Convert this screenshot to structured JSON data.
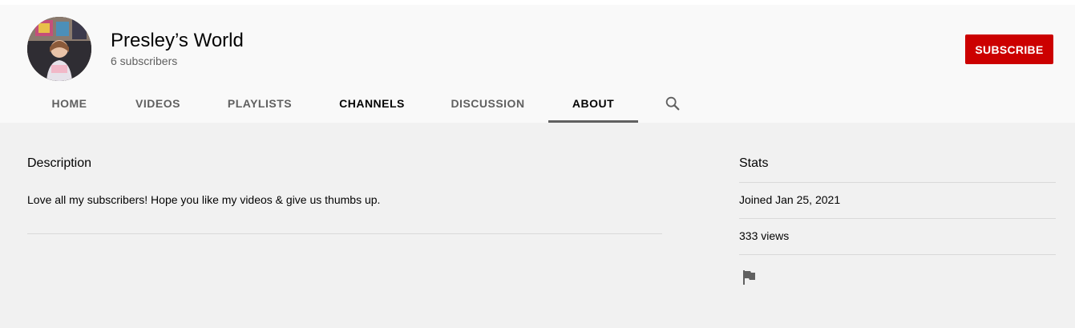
{
  "channel": {
    "name": "Presley’s World",
    "subscribers": "6 subscribers",
    "subscribe_label": "SUBSCRIBE"
  },
  "tabs": [
    {
      "label": "HOME",
      "active": false
    },
    {
      "label": "VIDEOS",
      "active": false
    },
    {
      "label": "PLAYLISTS",
      "active": false
    },
    {
      "label": "CHANNELS",
      "active": false
    },
    {
      "label": "DISCUSSION",
      "active": false
    },
    {
      "label": "ABOUT",
      "active": true
    }
  ],
  "icons": {
    "search": "search-icon",
    "flag": "flag-icon"
  },
  "about": {
    "description_title": "Description",
    "description_text": "Love all my subscribers! Hope you like my videos & give us thumbs up.",
    "stats_title": "Stats",
    "joined": "Joined Jan 25, 2021",
    "views": "333 views"
  },
  "colors": {
    "subscribe": "#cc0000",
    "header_bg": "#f9f9f9",
    "page_bg": "#f1f1f1",
    "active_tab_underline": "#606060"
  }
}
